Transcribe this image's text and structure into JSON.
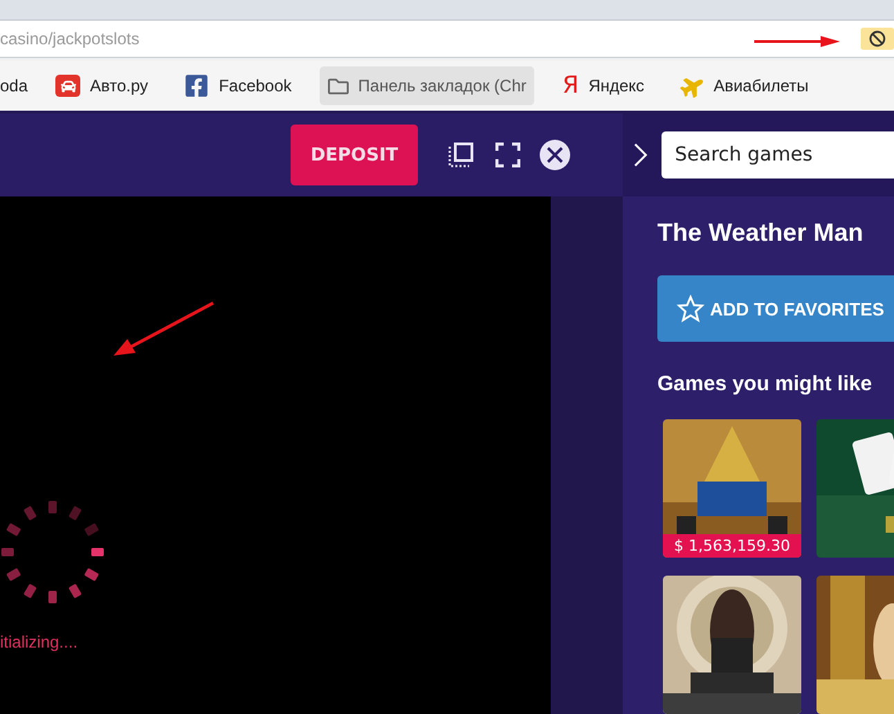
{
  "address_bar": {
    "url": "casino/jackpotslots",
    "blocked_indicator": true
  },
  "bookmarks": [
    {
      "label": "oda",
      "hovered": false
    },
    {
      "label": "Авто.ру",
      "hovered": false
    },
    {
      "label": "Facebook",
      "hovered": false
    },
    {
      "label": "Панель закладок (Chr",
      "hovered": true
    },
    {
      "label": "Яндекс",
      "glyph": "Я",
      "hovered": false
    },
    {
      "label": "Авиабилеты",
      "hovered": false
    }
  ],
  "game_header": {
    "deposit_button": "DEPOSIT"
  },
  "game": {
    "status": "itializing...."
  },
  "sidebar": {
    "search": {
      "placeholder": "Search games"
    },
    "title": "The Weather Man",
    "favorite_button": "ADD TO FAVORITES",
    "section_title": "Games you might like",
    "games": [
      {
        "kind": "picture",
        "jackpot": "$ 1,563,159.30"
      },
      {
        "kind": "picture"
      },
      {
        "kind": "picture"
      },
      {
        "kind": "picture"
      }
    ]
  }
}
